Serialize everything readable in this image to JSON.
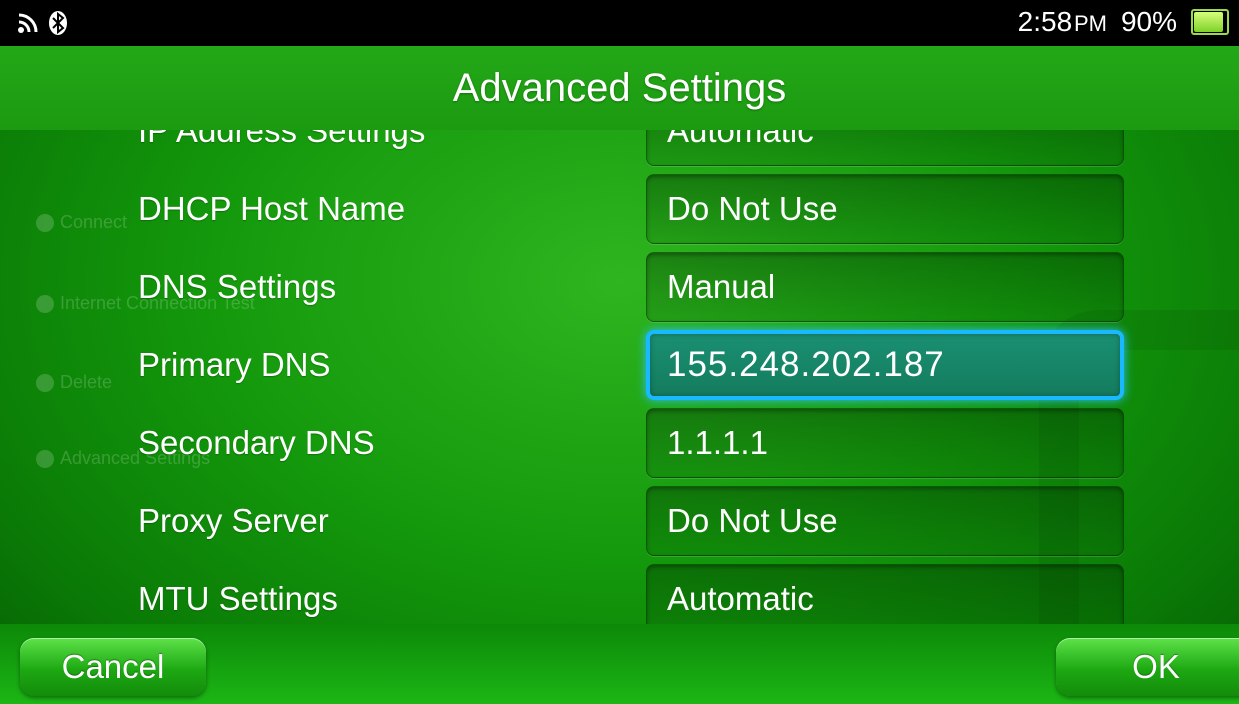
{
  "status_bar": {
    "time": "2:58",
    "meridiem": "PM",
    "battery_percent": "90%",
    "battery_level": 0.9,
    "icons": [
      "wifi-icon",
      "bluetooth-icon",
      "battery-icon"
    ]
  },
  "title": "Advanced Settings",
  "background_menu": [
    "Connect",
    "Internet Connection Test",
    "Delete",
    "Advanced Settings"
  ],
  "settings": [
    {
      "label": "IP Address Settings",
      "value": "Automatic"
    },
    {
      "label": "DHCP Host Name",
      "value": "Do Not Use"
    },
    {
      "label": "DNS Settings",
      "value": "Manual"
    },
    {
      "label": "Primary DNS",
      "value": "155.248.202.187",
      "selected": true
    },
    {
      "label": "Secondary DNS",
      "value": "1.1.1.1"
    },
    {
      "label": "Proxy Server",
      "value": "Do Not Use"
    },
    {
      "label": "MTU Settings",
      "value": "Automatic"
    }
  ],
  "buttons": {
    "cancel": "Cancel",
    "ok": "OK"
  },
  "colors": {
    "background": "#149a0c",
    "selection_border": "#19b9ff",
    "status_bar": "#000000"
  }
}
